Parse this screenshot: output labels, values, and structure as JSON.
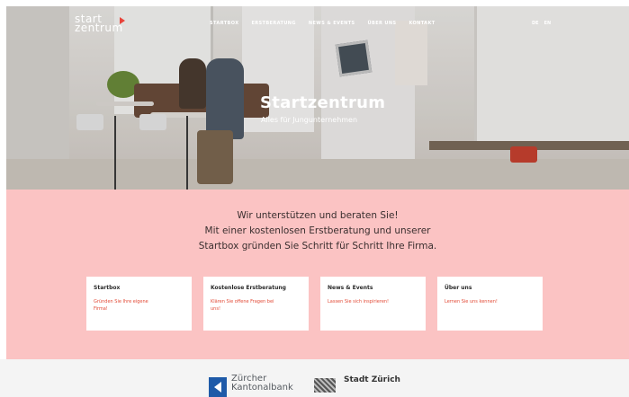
{
  "header": {
    "logo_line1": "start",
    "logo_line2": "zentrum",
    "nav": [
      "STARTBOX",
      "ERSTBERATUNG",
      "NEWS & EVENTS",
      "ÜBER UNS",
      "KONTAKT"
    ],
    "languages": [
      "DE",
      "EN"
    ]
  },
  "hero": {
    "title": "Startzentrum",
    "subtitle": "Alles für Jungunternehmen"
  },
  "intro": {
    "line1": "Wir unterstützen und beraten Sie!",
    "line2": "Mit einer kostenlosen Erstberatung und unserer",
    "line3": "Startbox gründen Sie Schritt für Schritt Ihre Firma."
  },
  "cards": [
    {
      "title": "Startbox",
      "link": "Gründen Sie Ihre eigene Firma!"
    },
    {
      "title": "Kostenlose Erstberatung",
      "link": "Klären Sie offene Fragen bei uns!"
    },
    {
      "title": "News & Events",
      "link": "Lassen Sie sich inspirieren!"
    },
    {
      "title": "Über uns",
      "link": "Lernen Sie uns kennen!"
    }
  ],
  "footer": {
    "sponsor1_line1": "Zürcher",
    "sponsor1_line2": "Kantonalbank",
    "sponsor2": "Stadt Zürich"
  },
  "colors": {
    "accent": "#e24a36",
    "pink_background": "#fbc3c3",
    "zkb_blue": "#1e5aa8"
  },
  "icons": [
    "logo-play-mark-icon",
    "zkb-logo-icon",
    "stadt-zuerich-logo-icon"
  ]
}
